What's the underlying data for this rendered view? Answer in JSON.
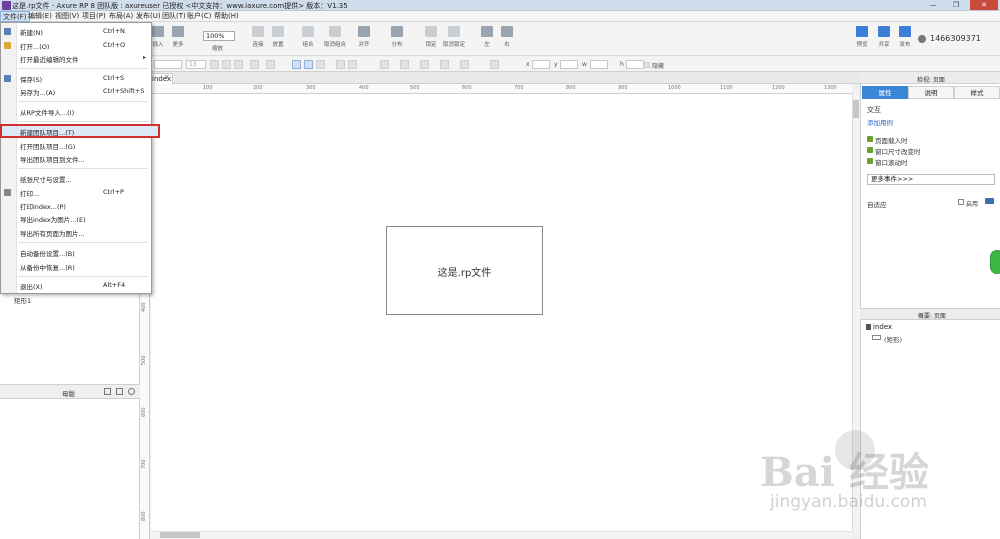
{
  "window": {
    "title": "这是.rp文件 - Axure RP 8 团队版 : axureuser 已授权     <中文支持：www.iaxure.com提供> 版本：V1.35",
    "min": "—",
    "max": "❐",
    "close": "✕"
  },
  "menubar": [
    "文件(F)",
    "编辑(E)",
    "视图(V)",
    "项目(P)",
    "布局(A)",
    "发布(U)",
    "团队(T)",
    "账户(C)",
    "帮助(H)"
  ],
  "file_menu": {
    "items": [
      {
        "label": "新建(N)",
        "shortcut": "Ctrl+N"
      },
      {
        "label": "打开...(O)",
        "shortcut": "Ctrl+O"
      },
      {
        "label": "打开最近编辑的文件",
        "arrow": "▸"
      },
      {
        "label": "保存(S)",
        "shortcut": "Ctrl+S"
      },
      {
        "label": "另存为...(A)",
        "shortcut": "Ctrl+Shift+S"
      },
      {
        "label": "从RP文件导入...(I)"
      },
      {
        "label": "新建团队项目...(T)"
      },
      {
        "label": "打开团队项目...(G)"
      },
      {
        "label": "导出团队项目到文件..."
      },
      {
        "label": "纸张尺寸与设置..."
      },
      {
        "label": "打印...",
        "shortcut": "Ctrl+P"
      },
      {
        "label": "打印index...(P)"
      },
      {
        "label": "导出index为图片...(E)"
      },
      {
        "label": "导出所有页面为图片..."
      },
      {
        "label": "自动备份设置...(B)"
      },
      {
        "label": "从备份中恢复...(R)"
      },
      {
        "label": "退出(X)",
        "shortcut": "Alt+F4"
      }
    ]
  },
  "toolbar": {
    "buttons": [
      "插入",
      "更多",
      "连接",
      "放置",
      "组合",
      "取消组合",
      "对齐",
      "分布",
      "锁定",
      "取消锁定",
      "左",
      "右",
      "预览",
      "共享",
      "发布"
    ],
    "zoom": "100%",
    "zoom_label": "缩放",
    "user": "1466309371"
  },
  "format_bar": {
    "font_size": "13",
    "x_label": "x",
    "y_label": "y",
    "w_label": "w",
    "h_label": "h",
    "hidden_label": "隐藏"
  },
  "left_panel": {
    "widget_label": "矩形1",
    "masters_title": "母版"
  },
  "canvas": {
    "tab": "index",
    "tab_close": "×",
    "shape_text": "这是.rp文件",
    "ruler_top": [
      "100",
      "200",
      "300",
      "400",
      "500",
      "600",
      "700",
      "800",
      "900",
      "1000",
      "1100",
      "1200",
      "1300"
    ],
    "ruler_left": [
      "400",
      "500",
      "600",
      "700",
      "800"
    ]
  },
  "right_panel": {
    "header": "检视: 页面",
    "tabs": [
      "属性",
      "说明",
      "样式"
    ],
    "interaction_title": "交互",
    "add_case": "添加用例",
    "events": [
      "页面载入时",
      "窗口尺寸改变时",
      "窗口滚动时"
    ],
    "more_events": "更多事件>>>",
    "adaptive": "自适应",
    "enable": "启用",
    "outline_header": "概要: 页面",
    "outline_page": "index",
    "outline_item": "(矩形)"
  },
  "watermark": {
    "brand": "Bai 经验",
    "url": "jingyan.baidu.com"
  },
  "colors": {
    "accent": "#3b86d6",
    "highlight_border": "#d0312d",
    "close_button": "#c94a3b"
  }
}
